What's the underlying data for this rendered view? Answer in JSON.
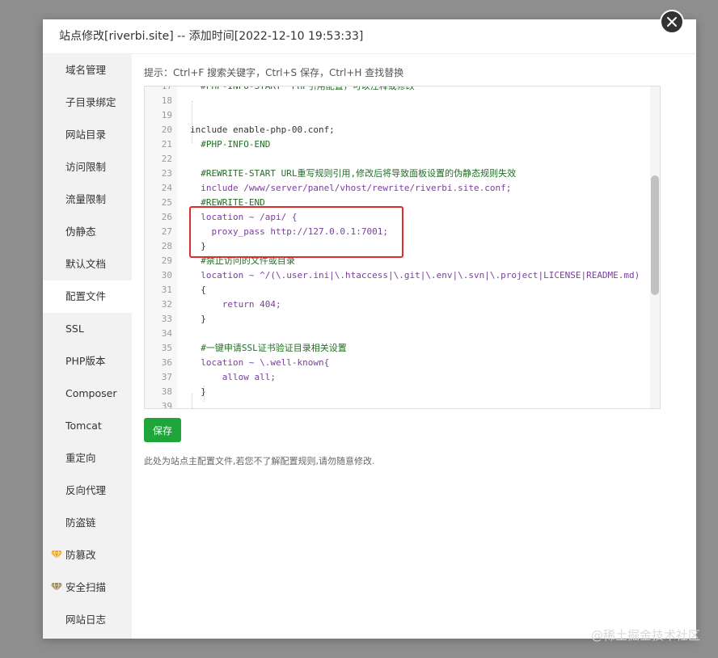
{
  "dialog": {
    "title": "站点修改[riverbi.site] -- 添加时间[2022-12-10 19:53:33]"
  },
  "sidebar": {
    "items": [
      {
        "label": "域名管理"
      },
      {
        "label": "子目录绑定"
      },
      {
        "label": "网站目录"
      },
      {
        "label": "访问限制"
      },
      {
        "label": "流量限制"
      },
      {
        "label": "伪静态"
      },
      {
        "label": "默认文档"
      },
      {
        "label": "配置文件",
        "active": true
      },
      {
        "label": "SSL"
      },
      {
        "label": "PHP版本"
      },
      {
        "label": "Composer"
      },
      {
        "label": "Tomcat"
      },
      {
        "label": "重定向"
      },
      {
        "label": "反向代理"
      },
      {
        "label": "防盗链"
      },
      {
        "label": "防篡改",
        "icon": "gem-icon"
      },
      {
        "label": "安全扫描",
        "icon": "gem-icon"
      },
      {
        "label": "网站日志"
      }
    ]
  },
  "hint": "提示：Ctrl+F 搜索关键字，Ctrl+S 保存，Ctrl+H 查找替换",
  "editor": {
    "lines": [
      {
        "n": "17",
        "cls": "cm",
        "text": "  #PHP-INFO-START  PHP引用配置，可以注释或修改"
      },
      {
        "n": "18",
        "cls": "txt",
        "text": ""
      },
      {
        "n": "19",
        "cls": "txt",
        "text": ""
      },
      {
        "n": "20",
        "cls": "txt",
        "text": "include enable-php-00.conf;"
      },
      {
        "n": "21",
        "cls": "cm",
        "text": "  #PHP-INFO-END"
      },
      {
        "n": "22",
        "cls": "txt",
        "text": ""
      },
      {
        "n": "23",
        "cls": "cm",
        "text": "  #REWRITE-START URL重写规则引用,修改后将导致面板设置的伪静态规则失效"
      },
      {
        "n": "24",
        "cls": "kw",
        "text": "  include /www/server/panel/vhost/rewrite/riverbi.site.conf;"
      },
      {
        "n": "25",
        "cls": "cm",
        "text": "  #REWRITE-END"
      },
      {
        "n": "26",
        "cls": "kw",
        "text": "  location ~ /api/ {"
      },
      {
        "n": "27",
        "cls": "kw",
        "text": "    proxy_pass http://127.0.0.1:7001;"
      },
      {
        "n": "28",
        "cls": "txt",
        "text": "  }"
      },
      {
        "n": "29",
        "cls": "cm",
        "text": "  #禁止访问的文件或目录"
      },
      {
        "n": "30",
        "cls": "kw",
        "text": "  location ~ ^/(\\.user.ini|\\.htaccess|\\.git|\\.env|\\.svn|\\.project|LICENSE|README.md)"
      },
      {
        "n": "31",
        "cls": "txt",
        "text": "  {"
      },
      {
        "n": "32",
        "cls": "kw",
        "text": "      return 404;"
      },
      {
        "n": "33",
        "cls": "txt",
        "text": "  }"
      },
      {
        "n": "34",
        "cls": "txt",
        "text": ""
      },
      {
        "n": "35",
        "cls": "cm",
        "text": "  #一键申请SSL证书验证目录相关设置"
      },
      {
        "n": "36",
        "cls": "kw",
        "text": "  location ~ \\.well-known{"
      },
      {
        "n": "37",
        "cls": "kw",
        "text": "      allow all;"
      },
      {
        "n": "38",
        "cls": "txt",
        "text": "  }"
      },
      {
        "n": "39",
        "cls": "txt",
        "text": ""
      }
    ]
  },
  "save_label": "保存",
  "note": "此处为站点主配置文件,若您不了解配置规则,请勿随意修改.",
  "watermark": "@稀土掘金技术社区",
  "colors": {
    "accent": "#20a53a",
    "highlight": "#e02c2c",
    "comment": "#236e25",
    "keyword": "#7a3e9d"
  }
}
